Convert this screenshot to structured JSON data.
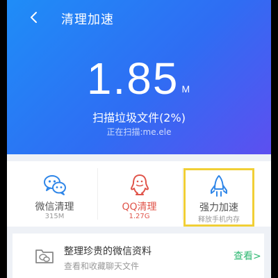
{
  "header": {
    "title": "清理加速"
  },
  "scan": {
    "size_value": "1.85",
    "size_unit": "M",
    "status": "扫描垃圾文件(2%)",
    "path": "正在扫描:me.ele"
  },
  "cards": [
    {
      "title": "微信清理",
      "subtitle": "315M",
      "icon": "wechat-icon",
      "title_color": "#555555",
      "sub_color": "#999999"
    },
    {
      "title": "QQ清理",
      "subtitle": "1.27G",
      "icon": "qq-icon",
      "title_color": "#e0544a",
      "sub_color": "#e0544a"
    },
    {
      "title": "强力加速",
      "subtitle": "释放手机内存",
      "icon": "rocket-icon",
      "title_color": "#555555",
      "sub_color": "#999999"
    }
  ],
  "promo": {
    "title": "整理珍贵的微信资料",
    "subtitle": "查看和收藏聊天文件",
    "link_label": "查看>",
    "icon": "folder-chat-icon"
  },
  "colors": {
    "hero_start": "#1f8df7",
    "hero_end": "#5d4ff0",
    "accent_green": "#2eb872",
    "accent_red": "#e0544a",
    "icon_blue": "#2f86e8",
    "highlight_yellow": "#f1cf35"
  }
}
